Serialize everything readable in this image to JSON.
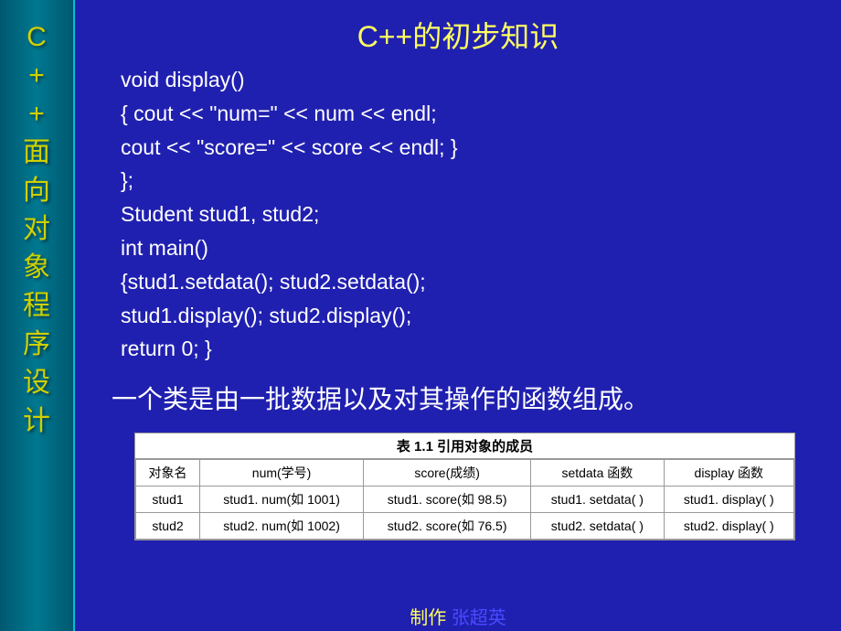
{
  "sidebar": {
    "chars": [
      "C",
      "+",
      "+",
      "面",
      "向",
      "对",
      "象",
      "程",
      "序",
      "设",
      "计"
    ]
  },
  "title": "C++的初步知识",
  "code": {
    "l1": "void display()",
    "l2": "{ cout << \"num=\" << num << endl;",
    "l3": "  cout << \"score=\" << score << endl; }",
    "l4": "};",
    "l5": "Student  stud1, stud2;",
    "l6": "int main()",
    "l7": "{stud1.setdata(); stud2.setdata();",
    "l8": "  stud1.display(); stud2.display();",
    "l9": "  return 0; }"
  },
  "summary": "一个类是由一批数据以及对其操作的函数组成。",
  "table": {
    "caption": "表 1.1  引用对象的成员",
    "headers": [
      "对象名",
      "num(学号)",
      "score(成绩)",
      "setdata 函数",
      "display 函数"
    ],
    "rows": [
      [
        "stud1",
        "stud1. num(如 1001)",
        "stud1. score(如 98.5)",
        "stud1. setdata( )",
        "stud1. display( )"
      ],
      [
        "stud2",
        "stud2. num(如 1002)",
        "stud2. score(如 76.5)",
        "stud2. setdata( )",
        "stud2. display( )"
      ]
    ]
  },
  "footer": {
    "label": "制作",
    "author": " 张超英"
  }
}
